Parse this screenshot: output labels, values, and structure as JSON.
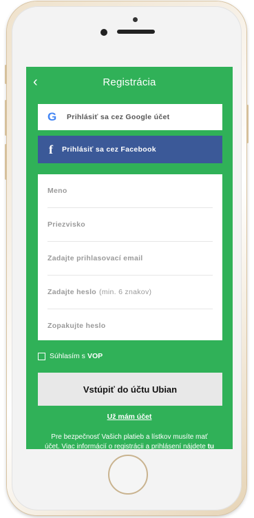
{
  "header": {
    "back_icon": "chevron-left-icon",
    "title": "Registrácia"
  },
  "social": {
    "google_label": "Prihlásiť sa cez Google účet",
    "google_icon": "G",
    "facebook_label": "Prihlásiť sa cez Facebook",
    "facebook_icon": "f"
  },
  "form": {
    "name": "Meno",
    "surname": "Priezvisko",
    "email": "Zadajte prihlasovací email",
    "password": "Zadajte heslo",
    "password_hint": "(min. 6 znakov)",
    "password_repeat": "Zopakujte heslo"
  },
  "terms": {
    "label": "Súhlasím s",
    "link": "VOP"
  },
  "actions": {
    "login_button": "Vstúpiť do účtu Ubian",
    "have_account": "Už mám účet"
  },
  "footer": {
    "line1": "Pre bezpečnosť Vašich platieb a lístkov musíte mať",
    "line2": "účet. Viac informácií o registrácii a prihlásení nájdete",
    "link": "tu"
  },
  "colors": {
    "screen_bg": "#30b158",
    "facebook": "#3b5998",
    "google_blue": "#4285f4"
  }
}
